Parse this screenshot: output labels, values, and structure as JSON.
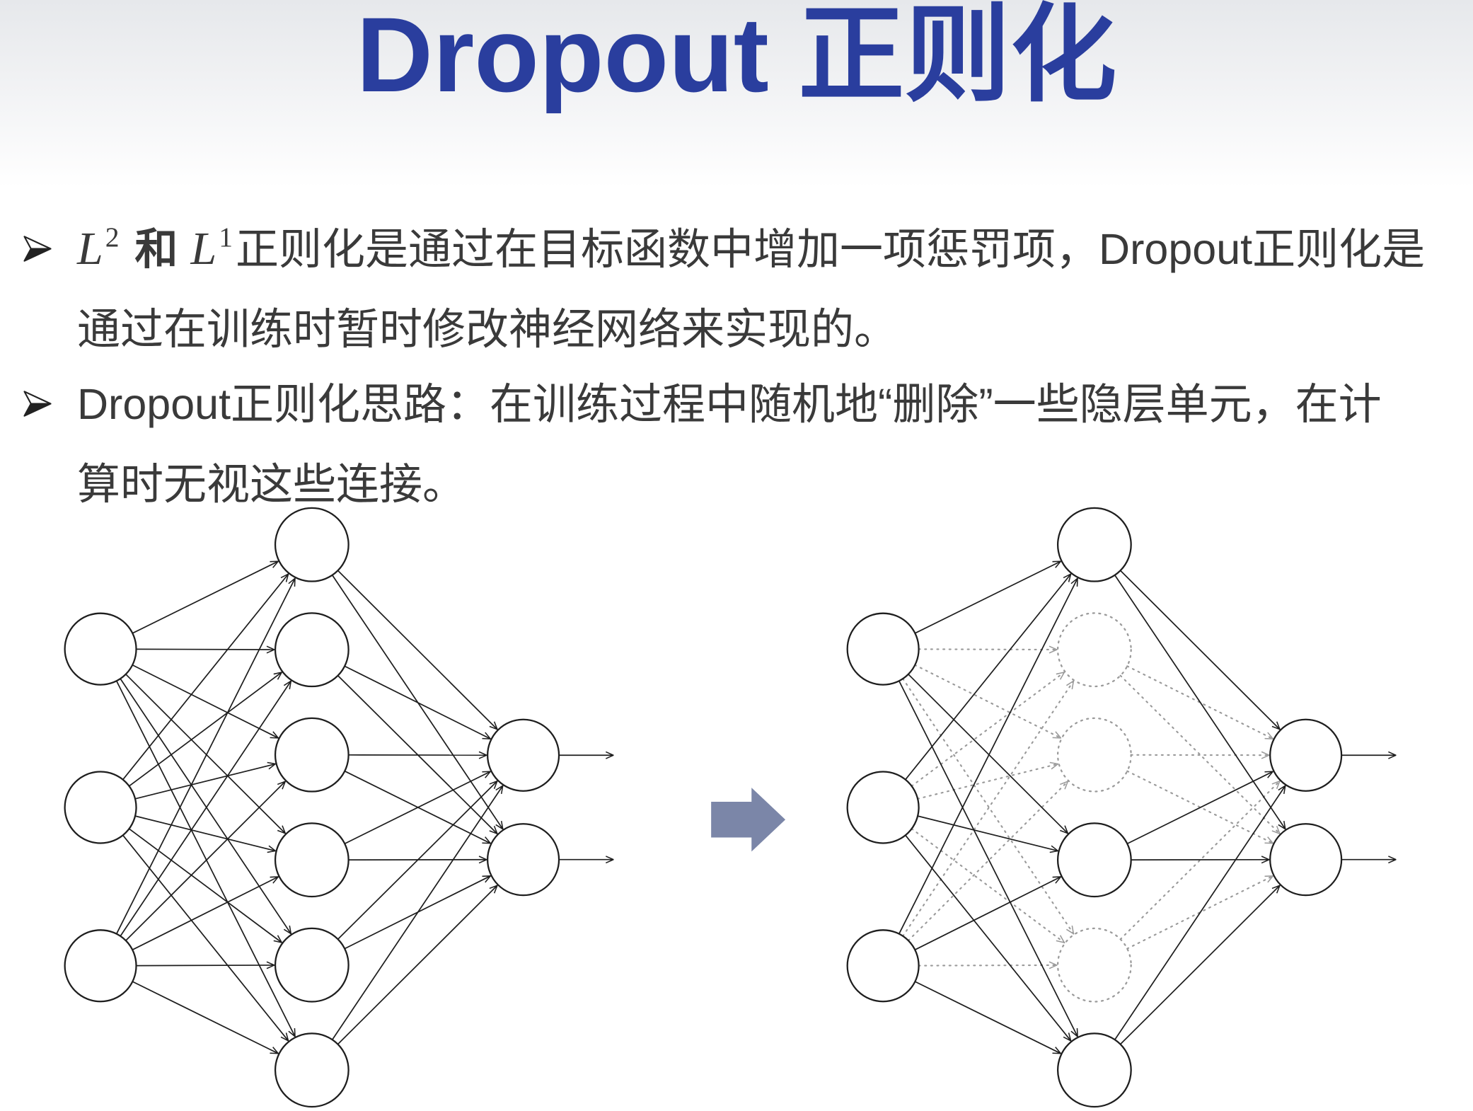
{
  "title": "Dropout 正则化",
  "colors": {
    "title": "#2a3e9e",
    "text": "#3a3a3a",
    "transform_arrow": "#7b86a8",
    "node_stroke": "#1e1e1e",
    "dropped_stroke": "#9a9a9a",
    "node_fill": "#ffffff"
  },
  "bullets": [
    {
      "icon": "arrowhead-bullet-icon",
      "math": {
        "first_base": "L",
        "first_sup": "2",
        "conj": "和",
        "second_base": "L",
        "second_sup": "1"
      },
      "lines": [
        "正则化是通过在目标函数中增加一项惩罚项，Dropout正则化是",
        "通过在训练时暂时修改神经网络来实现的。"
      ]
    },
    {
      "icon": "arrowhead-bullet-icon",
      "lines": [
        "Dropout正则化思路：在训练过程中随机地“删除”一些隐层单元，在计",
        "算时无视这些连接。"
      ]
    }
  ],
  "diagram": {
    "transform_icon": "right-arrow-icon",
    "networks": [
      {
        "layers": [
          3,
          6,
          2
        ],
        "dropped_hidden": []
      },
      {
        "layers": [
          3,
          6,
          2
        ],
        "dropped_hidden": [
          1,
          2,
          4
        ]
      }
    ]
  }
}
